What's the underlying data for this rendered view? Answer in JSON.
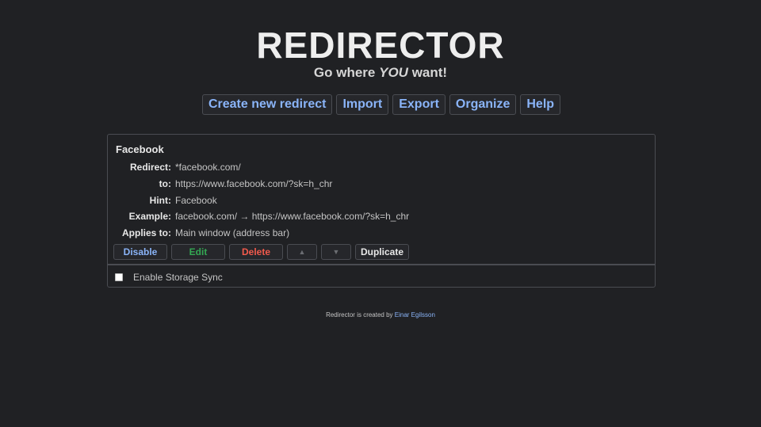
{
  "app": {
    "title": "REDIRECTOR",
    "tagline_before": "Go where",
    "tagline_emphasis": "YOU",
    "tagline_after": "want!"
  },
  "nav": {
    "create": "Create new redirect",
    "import": "Import",
    "export": "Export",
    "organize": "Organize",
    "help": "Help"
  },
  "rule": {
    "name": "Facebook",
    "rows": [
      {
        "label": "Redirect:",
        "value": "*facebook.com/"
      },
      {
        "label": "to:",
        "value": "https://www.facebook.com/?sk=h_chr"
      },
      {
        "label": "Hint:",
        "value": "Facebook"
      },
      {
        "label": "Example:",
        "value": "facebook.com/ → https://www.facebook.com/?sk=h_chr"
      },
      {
        "label": "Applies to:",
        "value": "Main window (address bar)"
      }
    ],
    "actions": {
      "disable": "Disable",
      "edit": "Edit",
      "delete": "Delete",
      "up": "▲",
      "down": "▼",
      "duplicate": "Duplicate"
    }
  },
  "sync": {
    "label": "Enable Storage Sync",
    "checked": false
  },
  "footer": {
    "text": "Redirector is created by",
    "author": "Einar Egilsson"
  },
  "colors": {
    "background": "#202124",
    "link": "#8ab4f8",
    "edit": "#34a853",
    "delete": "#f25a4c"
  }
}
